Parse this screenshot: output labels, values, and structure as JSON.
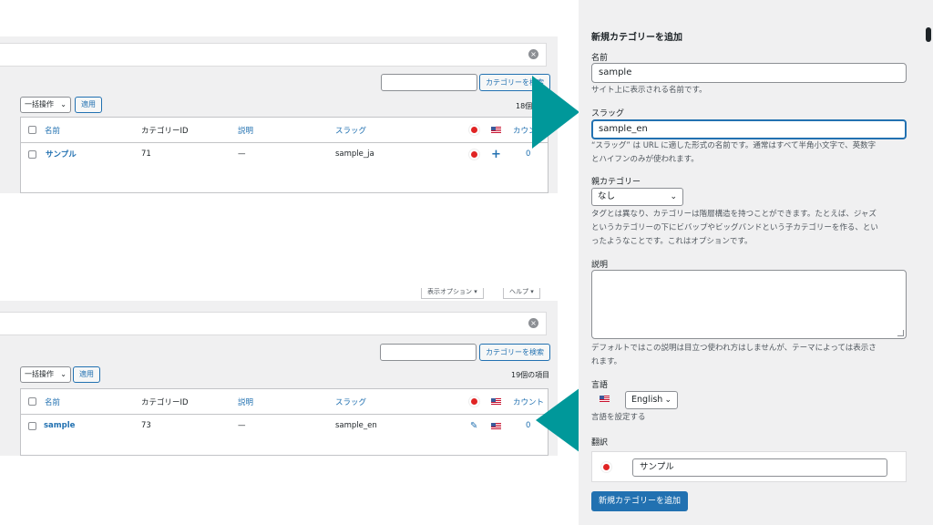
{
  "top_list": {
    "search_button": "カテゴリーを検索",
    "bulk_action": "一括操作",
    "apply": "適用",
    "item_count": "18個の",
    "headers": {
      "name": "名前",
      "id": "カテゴリーID",
      "description": "説明",
      "slug": "スラッグ",
      "count": "カウン"
    },
    "row": {
      "name": "サンプル",
      "id": "71",
      "description": "—",
      "slug": "sample_ja",
      "count": "0"
    }
  },
  "bottom_list": {
    "options_button": "表示オプション ▾",
    "help_button": "ヘルプ ▾",
    "search_button": "カテゴリーを検索",
    "bulk_action": "一括操作",
    "apply": "適用",
    "item_count": "19個の項目",
    "headers": {
      "name": "名前",
      "id": "カテゴリーID",
      "description": "説明",
      "slug": "スラッグ",
      "count": "カウント"
    },
    "row": {
      "name": "sample",
      "id": "73",
      "description": "—",
      "slug": "sample_en",
      "count": "0"
    }
  },
  "form": {
    "title": "新規カテゴリーを追加",
    "name_label": "名前",
    "name_value": "sample",
    "name_help": "サイト上に表示される名前です。",
    "slug_label": "スラッグ",
    "slug_value": "sample_en",
    "slug_help_1": "“スラッグ” は URL に適した形式の名前です。通常はすべて半角小文字で、英数字",
    "slug_help_2": "とハイフンのみが使われます。",
    "parent_label": "親カテゴリー",
    "parent_value": "なし",
    "parent_help_1": "タグとは異なり、カテゴリーは階層構造を持つことができます。たとえば、ジャズ",
    "parent_help_2": "というカテゴリーの下にビバップやビッグバンドという子カテゴリーを作る、とい",
    "parent_help_3": "ったようなことです。これはオプションです。",
    "description_label": "説明",
    "description_help_1": "デフォルトではこの説明は目立つ使われ方はしませんが、テーマによっては表示さ",
    "description_help_2": "れます。",
    "language_label": "言語",
    "language_value": "English",
    "language_help": "言語を設定する",
    "translation_label": "翻訳",
    "translation_value": "サンプル",
    "submit": "新規カテゴリーを追加"
  },
  "colors": {
    "accent": "#2271b1",
    "arrow": "#00989a",
    "panel_bg": "#f0f0f1"
  }
}
